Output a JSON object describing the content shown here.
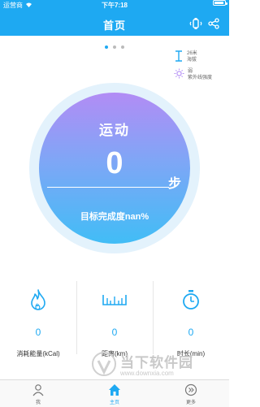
{
  "status_bar": {
    "carrier": "运营商",
    "time": "下午7:18",
    "battery_level": 0.9
  },
  "header": {
    "title": "首页",
    "icons": [
      "watch-icon",
      "share-icon"
    ]
  },
  "pager": {
    "pages": 3,
    "active": 1
  },
  "weather": {
    "altitude_value": "26米",
    "altitude_label": "海拔",
    "uv_value": "弱",
    "uv_label": "紫外线强度"
  },
  "main_circle": {
    "title": "运动",
    "steps": "0",
    "unit": "步",
    "completion_text": "目标完成度nan%"
  },
  "stats": [
    {
      "icon": "flame-icon",
      "value": "0",
      "label": "消耗能量(kCal)"
    },
    {
      "icon": "ruler-icon",
      "value": "0",
      "label": "距离(km)"
    },
    {
      "icon": "stopwatch-icon",
      "value": "0",
      "label": "时长(min)"
    }
  ],
  "watermark": {
    "name": "当下软件园",
    "url": "www.downxia.com"
  },
  "tabbar": {
    "items": [
      {
        "label": "我",
        "icon": "person-icon"
      },
      {
        "label": "主页",
        "icon": "home-icon"
      },
      {
        "label": "更多",
        "icon": "more-icon"
      }
    ],
    "active": 1,
    "accent": "#1ea9f2"
  },
  "colors": {
    "primary": "#1ea9f2",
    "gradient_top": "#b28cf5",
    "gradient_bottom": "#41bdf6"
  }
}
